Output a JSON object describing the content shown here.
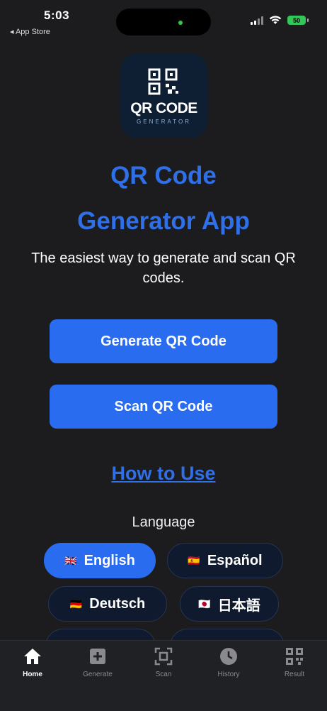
{
  "status_bar": {
    "time": "5:03",
    "back_app": "◂ App Store",
    "battery": "50"
  },
  "logo": {
    "name": "QR CODE",
    "subtitle": "GENERATOR"
  },
  "hero": {
    "title_line1": "QR Code",
    "title_line2": "Generator App",
    "subtitle": "The easiest way to generate and scan QR codes."
  },
  "buttons": {
    "generate": "Generate QR Code",
    "scan": "Scan QR Code"
  },
  "how_to": "How to Use",
  "language": {
    "label": "Language",
    "options": [
      {
        "flag": "🇬🇧",
        "name": "English",
        "selected": true
      },
      {
        "flag": "🇪🇸",
        "name": "Español",
        "selected": false
      },
      {
        "flag": "🇩🇪",
        "name": "Deutsch",
        "selected": false
      },
      {
        "flag": "🇯🇵",
        "name": "日本語",
        "selected": false
      }
    ]
  },
  "tabs": [
    {
      "label": "Home",
      "icon": "home-icon",
      "active": true
    },
    {
      "label": "Generate",
      "icon": "plus-square-icon",
      "active": false
    },
    {
      "label": "Scan",
      "icon": "scan-icon",
      "active": false
    },
    {
      "label": "History",
      "icon": "clock-icon",
      "active": false
    },
    {
      "label": "Result",
      "icon": "qr-icon",
      "active": false
    }
  ],
  "colors": {
    "accent": "#2a6cf0",
    "title": "#2f6fe8",
    "background": "#1c1c1e"
  }
}
